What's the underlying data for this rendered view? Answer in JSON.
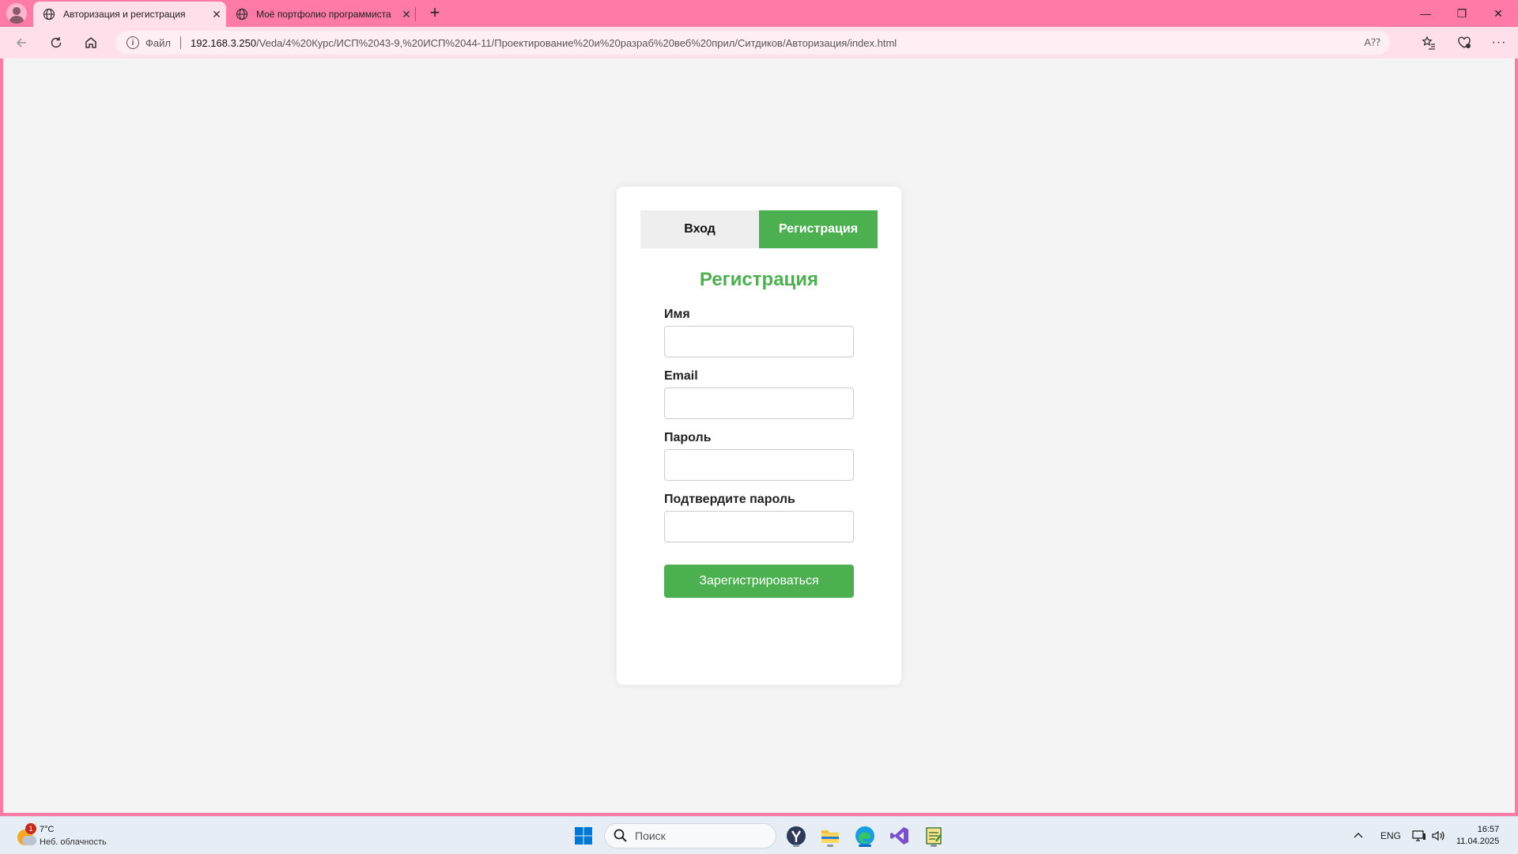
{
  "browser": {
    "tabs": [
      {
        "title": "Авторизация и регистрация",
        "active": true
      },
      {
        "title": "Моё портфолио программиста",
        "active": false
      }
    ],
    "new_tab_label": "+",
    "address": {
      "scheme_label": "Файл",
      "host": "192.168.3.250",
      "path": "/Veda/4%20Курс/ИСП%2043-9,%20ИСП%2044-11/Проектирование%20и%20разраб%20веб%20прил/Ситдиков/Авторизация/index.html"
    }
  },
  "page": {
    "tabs": {
      "login_label": "Вход",
      "register_label": "Регистрация"
    },
    "form": {
      "title": "Регистрация",
      "fields": {
        "name_label": "Имя",
        "name_value": "",
        "email_label": "Email",
        "email_value": "",
        "password_label": "Пароль",
        "password_value": "",
        "confirm_label": "Подтвердите пароль",
        "confirm_value": ""
      },
      "submit_label": "Зарегистрироваться"
    },
    "colors": {
      "accent": "#4caf50",
      "browser_frame": "#ff7aa6",
      "page_background": "#f4f4f4"
    }
  },
  "taskbar": {
    "weather": {
      "badge": "1",
      "temperature": "7°C",
      "condition": "Неб. облачность"
    },
    "search_placeholder": "Поиск",
    "language": "ENG",
    "time": "16:57",
    "date": "11.04.2025"
  }
}
